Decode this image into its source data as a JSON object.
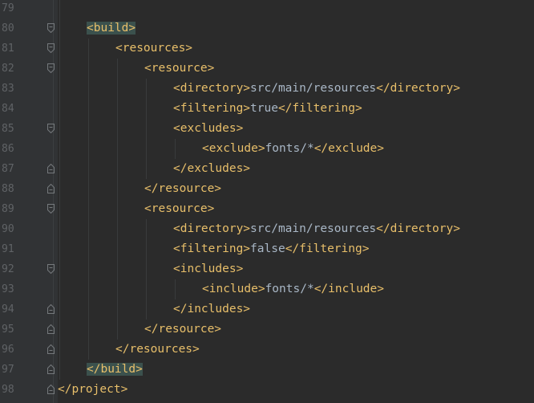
{
  "colors": {
    "background": "#2b2b2b",
    "gutter": "#313335",
    "line_number": "#606366",
    "tag": "#e8bf6a",
    "text": "#a9b7c6",
    "match_highlight": "#3b514d"
  },
  "lines": [
    {
      "num": "79",
      "indent": 0,
      "fold": "none",
      "tokens": []
    },
    {
      "num": "80",
      "indent": 1,
      "fold": "start",
      "tokens": [
        {
          "t": "<build>",
          "k": "tag",
          "hl": true
        }
      ]
    },
    {
      "num": "81",
      "indent": 2,
      "fold": "start",
      "tokens": [
        {
          "t": "<resources>",
          "k": "tag"
        }
      ]
    },
    {
      "num": "82",
      "indent": 3,
      "fold": "start",
      "tokens": [
        {
          "t": "<resource>",
          "k": "tag"
        }
      ]
    },
    {
      "num": "83",
      "indent": 4,
      "fold": "none",
      "tokens": [
        {
          "t": "<directory>",
          "k": "tag"
        },
        {
          "t": "src/main/resources",
          "k": "txt"
        },
        {
          "t": "</directory>",
          "k": "tag"
        }
      ]
    },
    {
      "num": "84",
      "indent": 4,
      "fold": "none",
      "tokens": [
        {
          "t": "<filtering>",
          "k": "tag"
        },
        {
          "t": "true",
          "k": "txt"
        },
        {
          "t": "</filtering>",
          "k": "tag"
        }
      ]
    },
    {
      "num": "85",
      "indent": 4,
      "fold": "start",
      "tokens": [
        {
          "t": "<excludes>",
          "k": "tag"
        }
      ]
    },
    {
      "num": "86",
      "indent": 5,
      "fold": "none",
      "tokens": [
        {
          "t": "<exclude>",
          "k": "tag"
        },
        {
          "t": "fonts/*",
          "k": "txt"
        },
        {
          "t": "</exclude>",
          "k": "tag"
        }
      ]
    },
    {
      "num": "87",
      "indent": 4,
      "fold": "end",
      "tokens": [
        {
          "t": "</excludes>",
          "k": "tag"
        }
      ]
    },
    {
      "num": "88",
      "indent": 3,
      "fold": "end",
      "tokens": [
        {
          "t": "</resource>",
          "k": "tag"
        }
      ]
    },
    {
      "num": "89",
      "indent": 3,
      "fold": "start",
      "tokens": [
        {
          "t": "<resource>",
          "k": "tag"
        }
      ]
    },
    {
      "num": "90",
      "indent": 4,
      "fold": "none",
      "tokens": [
        {
          "t": "<directory>",
          "k": "tag"
        },
        {
          "t": "src/main/resources",
          "k": "txt"
        },
        {
          "t": "</directory>",
          "k": "tag"
        }
      ]
    },
    {
      "num": "91",
      "indent": 4,
      "fold": "none",
      "tokens": [
        {
          "t": "<filtering>",
          "k": "tag"
        },
        {
          "t": "false",
          "k": "txt"
        },
        {
          "t": "</filtering>",
          "k": "tag"
        }
      ]
    },
    {
      "num": "92",
      "indent": 4,
      "fold": "start",
      "tokens": [
        {
          "t": "<includes>",
          "k": "tag"
        }
      ]
    },
    {
      "num": "93",
      "indent": 5,
      "fold": "none",
      "tokens": [
        {
          "t": "<include>",
          "k": "tag"
        },
        {
          "t": "fonts/*",
          "k": "txt"
        },
        {
          "t": "</include>",
          "k": "tag"
        }
      ]
    },
    {
      "num": "94",
      "indent": 4,
      "fold": "end",
      "tokens": [
        {
          "t": "</includes>",
          "k": "tag"
        }
      ]
    },
    {
      "num": "95",
      "indent": 3,
      "fold": "end",
      "tokens": [
        {
          "t": "</resource>",
          "k": "tag"
        }
      ]
    },
    {
      "num": "96",
      "indent": 2,
      "fold": "end",
      "tokens": [
        {
          "t": "</resources>",
          "k": "tag"
        }
      ]
    },
    {
      "num": "97",
      "indent": 1,
      "fold": "end",
      "tokens": [
        {
          "t": "</build>",
          "k": "tag",
          "hl": true
        }
      ]
    },
    {
      "num": "98",
      "indent": 0,
      "fold": "end",
      "tokens": [
        {
          "t": "</project>",
          "k": "tag"
        }
      ]
    }
  ]
}
